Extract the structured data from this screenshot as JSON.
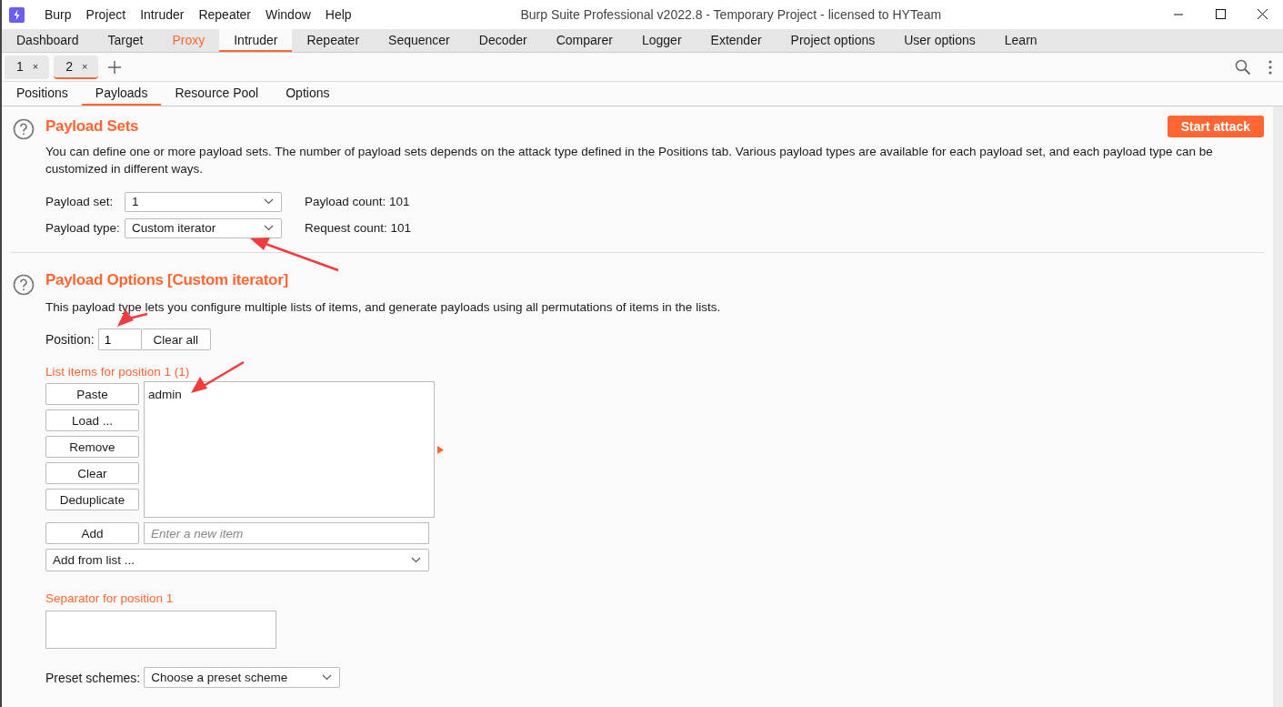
{
  "window": {
    "title": "Burp Suite Professional v2022.8 - Temporary Project - licensed to HYTeam"
  },
  "menu_bar": [
    "Burp",
    "Project",
    "Intruder",
    "Repeater",
    "Window",
    "Help"
  ],
  "main_tabs": [
    {
      "label": "Dashboard",
      "selected": false,
      "highlighted": false
    },
    {
      "label": "Target",
      "selected": false,
      "highlighted": false
    },
    {
      "label": "Proxy",
      "selected": false,
      "highlighted": true
    },
    {
      "label": "Intruder",
      "selected": true,
      "highlighted": false
    },
    {
      "label": "Repeater",
      "selected": false,
      "highlighted": false
    },
    {
      "label": "Sequencer",
      "selected": false,
      "highlighted": false
    },
    {
      "label": "Decoder",
      "selected": false,
      "highlighted": false
    },
    {
      "label": "Comparer",
      "selected": false,
      "highlighted": false
    },
    {
      "label": "Logger",
      "selected": false,
      "highlighted": false
    },
    {
      "label": "Extender",
      "selected": false,
      "highlighted": false
    },
    {
      "label": "Project options",
      "selected": false,
      "highlighted": false
    },
    {
      "label": "User options",
      "selected": false,
      "highlighted": false
    },
    {
      "label": "Learn",
      "selected": false,
      "highlighted": false
    }
  ],
  "attack_tabs": [
    {
      "label": "1",
      "close": "×",
      "selected": false
    },
    {
      "label": "2",
      "close": "×",
      "selected": true
    }
  ],
  "sub_tabs": [
    {
      "label": "Positions",
      "selected": false
    },
    {
      "label": "Payloads",
      "selected": true
    },
    {
      "label": "Resource Pool",
      "selected": false
    },
    {
      "label": "Options",
      "selected": false
    }
  ],
  "payload_sets": {
    "title": "Payload Sets",
    "start_button": "Start attack",
    "description": "You can define one or more payload sets. The number of payload sets depends on the attack type defined in the Positions tab. Various payload types are available for each payload set, and each payload type can be customized in different ways.",
    "fields": [
      {
        "label": "Payload set:",
        "value": "1",
        "info": "Payload count: 101"
      },
      {
        "label": "Payload type:",
        "value": "Custom iterator",
        "info": "Request count: 101"
      }
    ]
  },
  "payload_options": {
    "title": "Payload Options [Custom iterator]",
    "description": "This payload type lets you configure multiple lists of items, and generate payloads using all permutations of items in the lists.",
    "position": {
      "label": "Position:",
      "value": "1"
    },
    "clear_all": "Clear all",
    "list_label": "List items for position 1 (1)",
    "list_buttons": [
      "Paste",
      "Load ...",
      "Remove",
      "Clear",
      "Deduplicate"
    ],
    "items": [
      "admin"
    ],
    "add_button": "Add",
    "new_item": {
      "placeholder": "Enter a new item"
    },
    "add_from_list": "Add from list ...",
    "separator_label": "Separator for position 1",
    "preset": {
      "label": "Preset schemes:",
      "value": "Choose a preset scheme"
    }
  }
}
